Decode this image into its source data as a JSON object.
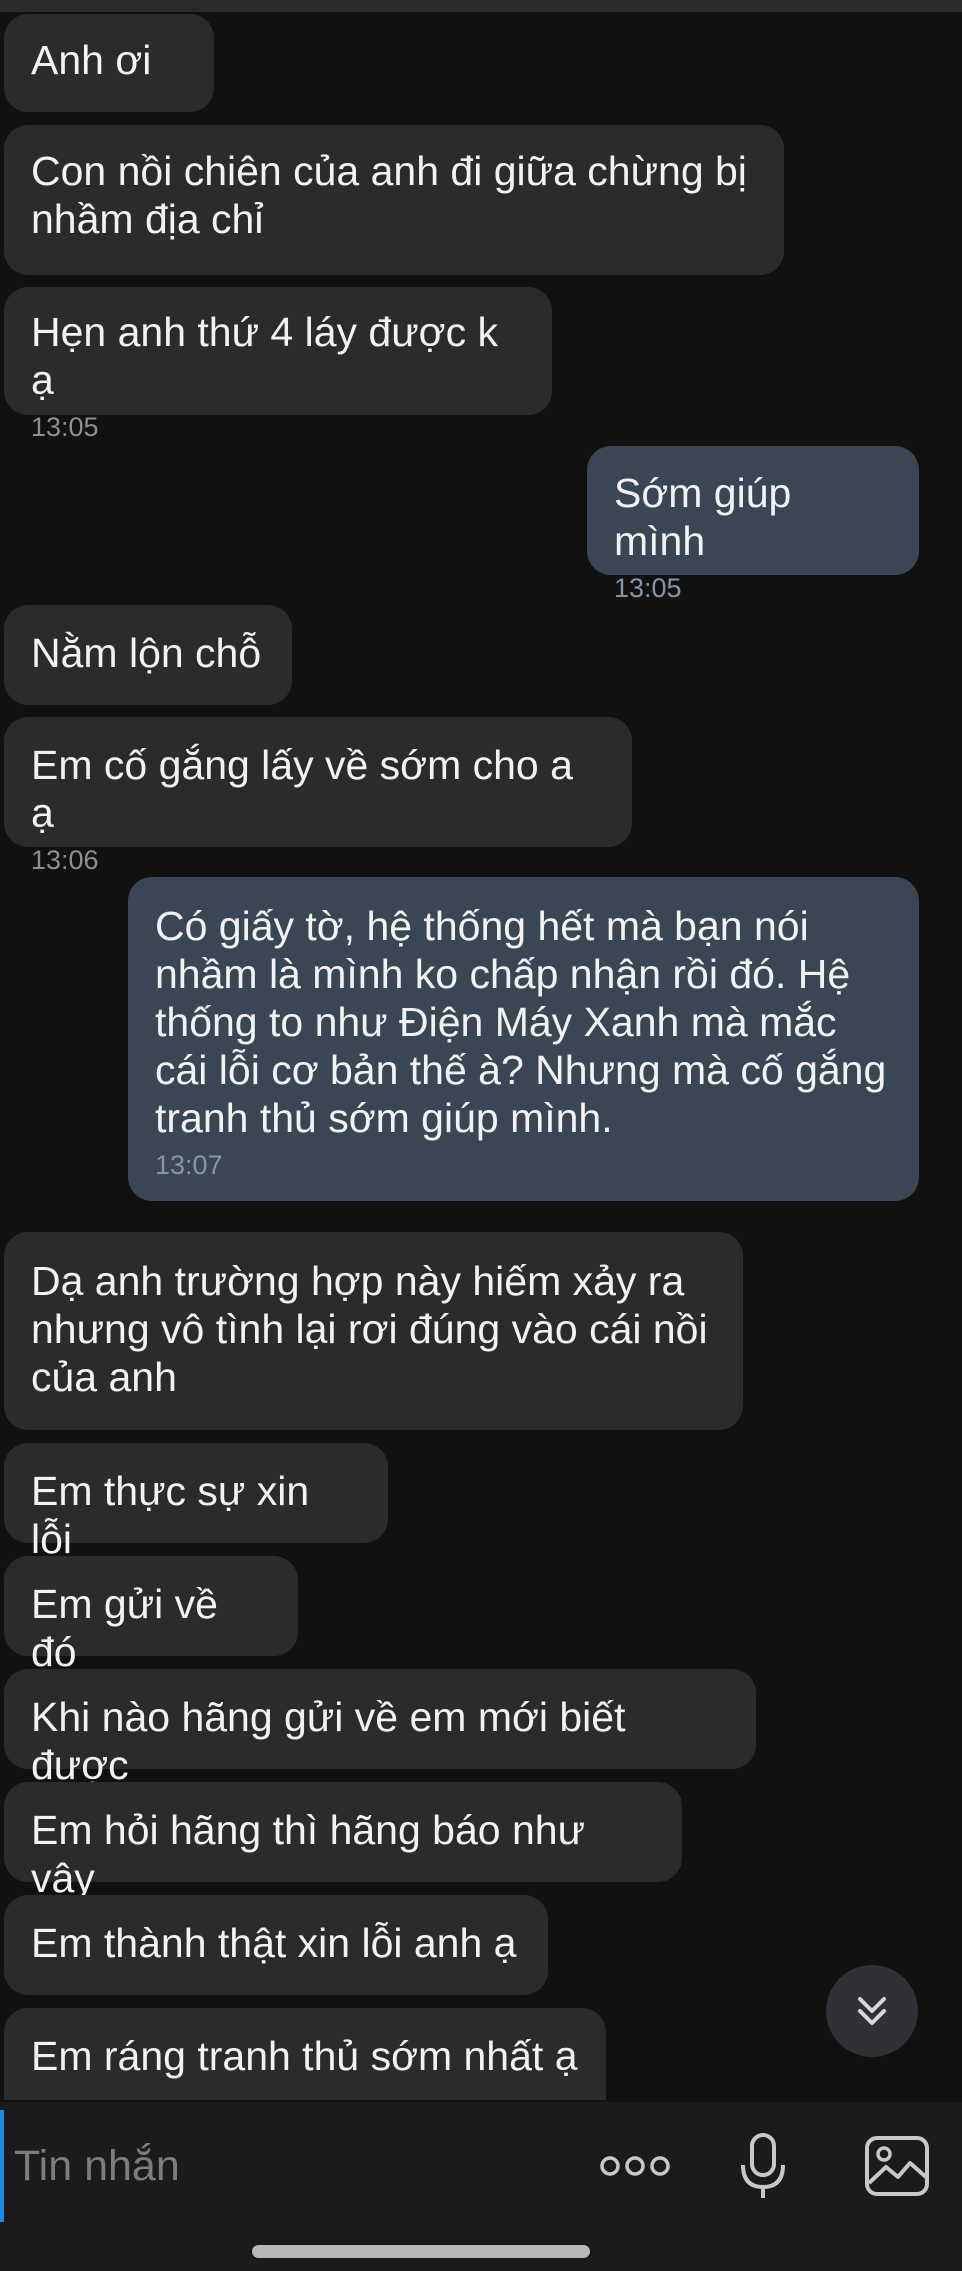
{
  "messages": [
    {
      "dir": "in",
      "text": "Anh ơi",
      "time": ""
    },
    {
      "dir": "in",
      "text": "Con nồi chiên của anh đi giữa chừng bị\nnhầm địa chỉ",
      "time": ""
    },
    {
      "dir": "in",
      "text": "Hẹn anh thứ 4 láy được k ạ",
      "time": "13:05"
    },
    {
      "dir": "out",
      "text": "Sớm giúp mình",
      "time": "13:05"
    },
    {
      "dir": "in",
      "text": "Nằm lộn chỗ",
      "time": ""
    },
    {
      "dir": "in",
      "text": "Em cố gắng lấy về sớm cho a ạ",
      "time": "13:06"
    },
    {
      "dir": "out",
      "text": "Có giấy tờ, hệ thống hết mà bạn nói\nnhầm là mình ko chấp nhận rồi đó. Hệ\nthống to như Điện Máy Xanh mà mắc\ncái lỗi cơ bản thế à? Nhưng mà cố gắng\ntranh thủ sớm giúp mình.",
      "time": "13:07"
    },
    {
      "dir": "in",
      "text": "Dạ anh trường hợp này hiếm xảy ra\nnhưng vô tình lại rơi đúng vào cái nồi\ncủa anh",
      "time": ""
    },
    {
      "dir": "in",
      "text": "Em thực sự xin lỗi",
      "time": ""
    },
    {
      "dir": "in",
      "text": "Em gửi về đó",
      "time": ""
    },
    {
      "dir": "in",
      "text": "Khi nào hãng gửi về em mới biết được",
      "time": ""
    },
    {
      "dir": "in",
      "text": "Em hỏi hãng thì hãng báo như vậy",
      "time": ""
    },
    {
      "dir": "in",
      "text": "Em thành thật xin lỗi anh ạ",
      "time": ""
    },
    {
      "dir": "in",
      "text": "Em ráng tranh thủ sớm nhất ạ",
      "time": ""
    }
  ],
  "composer": {
    "placeholder": "Tin nhắn",
    "icons": [
      "more-icon",
      "microphone-icon",
      "image-icon"
    ]
  },
  "scroll_button": {
    "icon": "double-chevron-down-icon"
  },
  "colors": {
    "background": "#111111",
    "incoming": "#2b2b2d",
    "outgoing": "#3b4654",
    "cursor": "#1e88e5"
  }
}
